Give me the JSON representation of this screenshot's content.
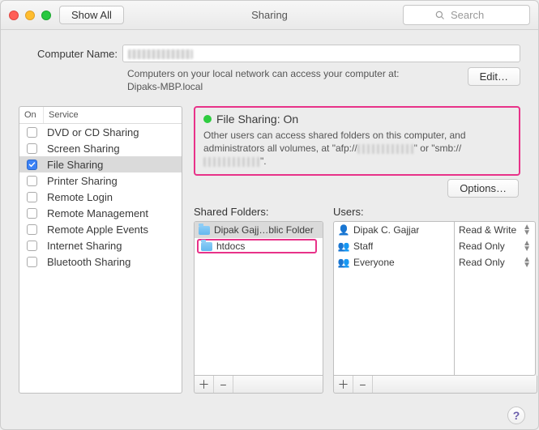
{
  "titlebar": {
    "show_all": "Show All",
    "title": "Sharing",
    "search_placeholder": "Search"
  },
  "computer": {
    "label": "Computer Name:",
    "value": "",
    "subtext_1": "Computers on your local network can access your computer at:",
    "subtext_2": "Dipaks-MBP.local",
    "edit": "Edit…"
  },
  "services": {
    "head_on": "On",
    "head_service": "Service",
    "items": [
      {
        "label": "DVD or CD Sharing",
        "on": false,
        "sel": false
      },
      {
        "label": "Screen Sharing",
        "on": false,
        "sel": false
      },
      {
        "label": "File Sharing",
        "on": true,
        "sel": true
      },
      {
        "label": "Printer Sharing",
        "on": false,
        "sel": false
      },
      {
        "label": "Remote Login",
        "on": false,
        "sel": false
      },
      {
        "label": "Remote Management",
        "on": false,
        "sel": false
      },
      {
        "label": "Remote Apple Events",
        "on": false,
        "sel": false
      },
      {
        "label": "Internet Sharing",
        "on": false,
        "sel": false
      },
      {
        "label": "Bluetooth Sharing",
        "on": false,
        "sel": false
      }
    ]
  },
  "status": {
    "title": "File Sharing: On",
    "desc_1": "Other users can access shared folders on this computer, and administrators all volumes, at \"afp://",
    "desc_2": "\" or \"smb://",
    "desc_3": "\"."
  },
  "options": "Options…",
  "folders": {
    "title": "Shared Folders:",
    "items": [
      {
        "label": "Dipak Gajj…blic Folder",
        "sel": true
      },
      {
        "label": "htdocs",
        "sel": false,
        "highlight": true
      }
    ]
  },
  "users": {
    "title": "Users:",
    "items": [
      {
        "icon": "👤",
        "label": "Dipak C. Gajjar"
      },
      {
        "icon": "👥",
        "label": "Staff"
      },
      {
        "icon": "👥",
        "label": "Everyone"
      }
    ]
  },
  "perms": [
    "Read & Write",
    "Read Only",
    "Read Only"
  ],
  "help": "?"
}
